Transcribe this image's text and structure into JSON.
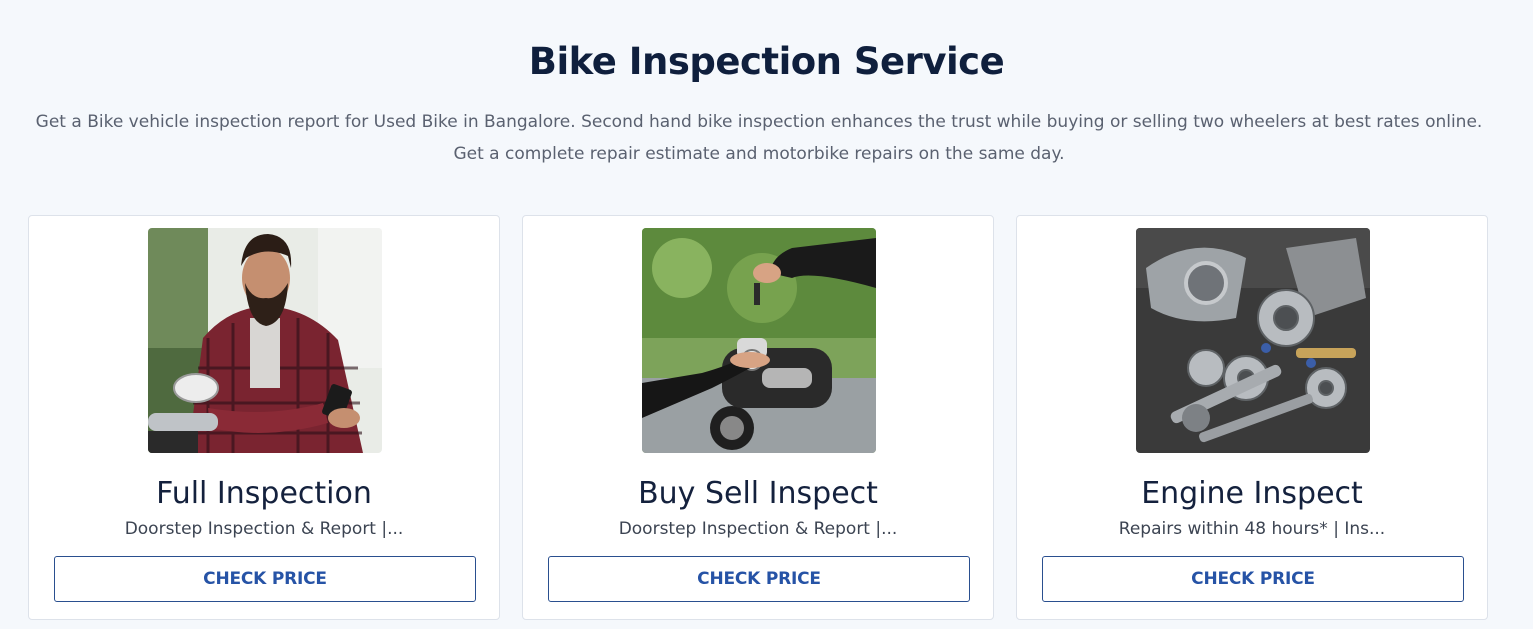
{
  "section": {
    "title": "Bike Inspection Service",
    "description": "Get a Bike vehicle inspection report for Used Bike in Bangalore. Second hand bike inspection enhances the trust while buying or selling two wheelers at best rates online. Get a complete repair estimate and motorbike repairs on the same day."
  },
  "cards": [
    {
      "title": "Full Inspection",
      "description": "Doorstep Inspection & Report |...",
      "button_label": "CHECK PRICE",
      "image": "man-with-phone-on-motorbike-photo"
    },
    {
      "title": "Buy Sell Inspect",
      "description": "Doorstep Inspection & Report |...",
      "button_label": "CHECK PRICE",
      "image": "key-handover-motorbike-photo"
    },
    {
      "title": "Engine Inspect",
      "description": "Repairs within 48 hours* | Ins...",
      "button_label": "CHECK PRICE",
      "image": "engine-gears-parts-photo"
    }
  ],
  "colors": {
    "background": "#f5f8fc",
    "title": "#0f1f3d",
    "button_border": "#2a4f8f",
    "button_text": "#2653a6"
  }
}
